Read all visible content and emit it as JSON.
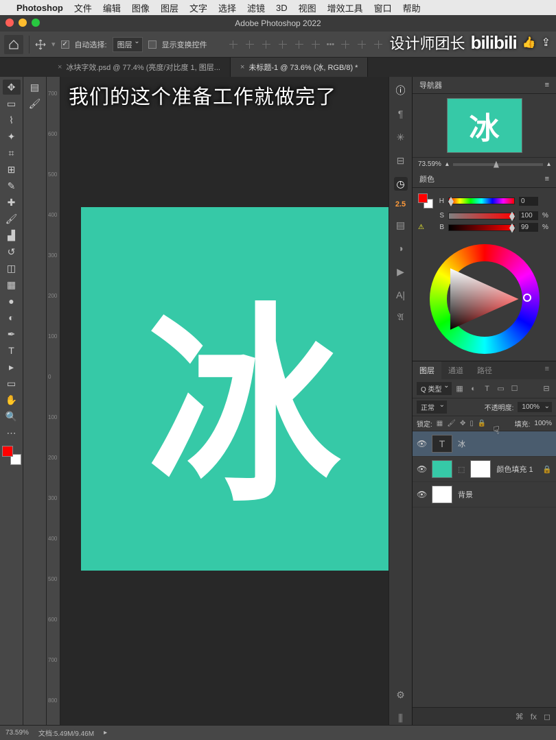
{
  "menubar": {
    "app": "Photoshop",
    "items": [
      "文件",
      "编辑",
      "图像",
      "图层",
      "文字",
      "选择",
      "滤镜",
      "3D",
      "视图",
      "增效工具",
      "窗口",
      "帮助"
    ]
  },
  "window_title": "Adobe Photoshop 2022",
  "optbar": {
    "auto_select": "自动选择:",
    "target": "图层",
    "show_transform": "显示变换控件"
  },
  "tabs": [
    {
      "label": "冰块字效.psd @ 77.4% (亮度/对比度 1, 图层...",
      "active": false
    },
    {
      "label": "未标题-1 @ 73.6% (冰, RGB/8) *",
      "active": true
    }
  ],
  "canvas": {
    "glyph": "冰",
    "bg": "#36c9a7"
  },
  "subtitle": "我们的这个准备工作就做完了",
  "watermark": {
    "text": "设计师团长",
    "brand": "bilibili"
  },
  "right_strip": {
    "num": "2.5"
  },
  "navigator": {
    "title": "导航器",
    "zoom": "73.59%"
  },
  "color_panel": {
    "title": "颜色",
    "rows": [
      {
        "label": "H",
        "value": "0",
        "unit": ""
      },
      {
        "label": "S",
        "value": "100",
        "unit": "%"
      },
      {
        "label": "B",
        "value": "99",
        "unit": "%"
      }
    ]
  },
  "layer_tabs": [
    "图层",
    "通道",
    "路径"
  ],
  "layer_filter": {
    "kind": "Q 类型"
  },
  "layer_opts": {
    "blend": "正常",
    "opacity_label": "不透明度:",
    "opacity": "100%",
    "fill_label": "填充:",
    "fill": "100%",
    "lock_label": "锁定:"
  },
  "layers": [
    {
      "name": "冰",
      "type": "text",
      "visible": true,
      "selected": true,
      "locked": false
    },
    {
      "name": "颜色填充 1",
      "type": "fill",
      "visible": true,
      "selected": false,
      "locked": true
    },
    {
      "name": "背景",
      "type": "bg",
      "visible": true,
      "selected": false,
      "locked": false
    }
  ],
  "status": {
    "zoom": "73.59%",
    "doc": "文档:5.49M/9.46M"
  }
}
